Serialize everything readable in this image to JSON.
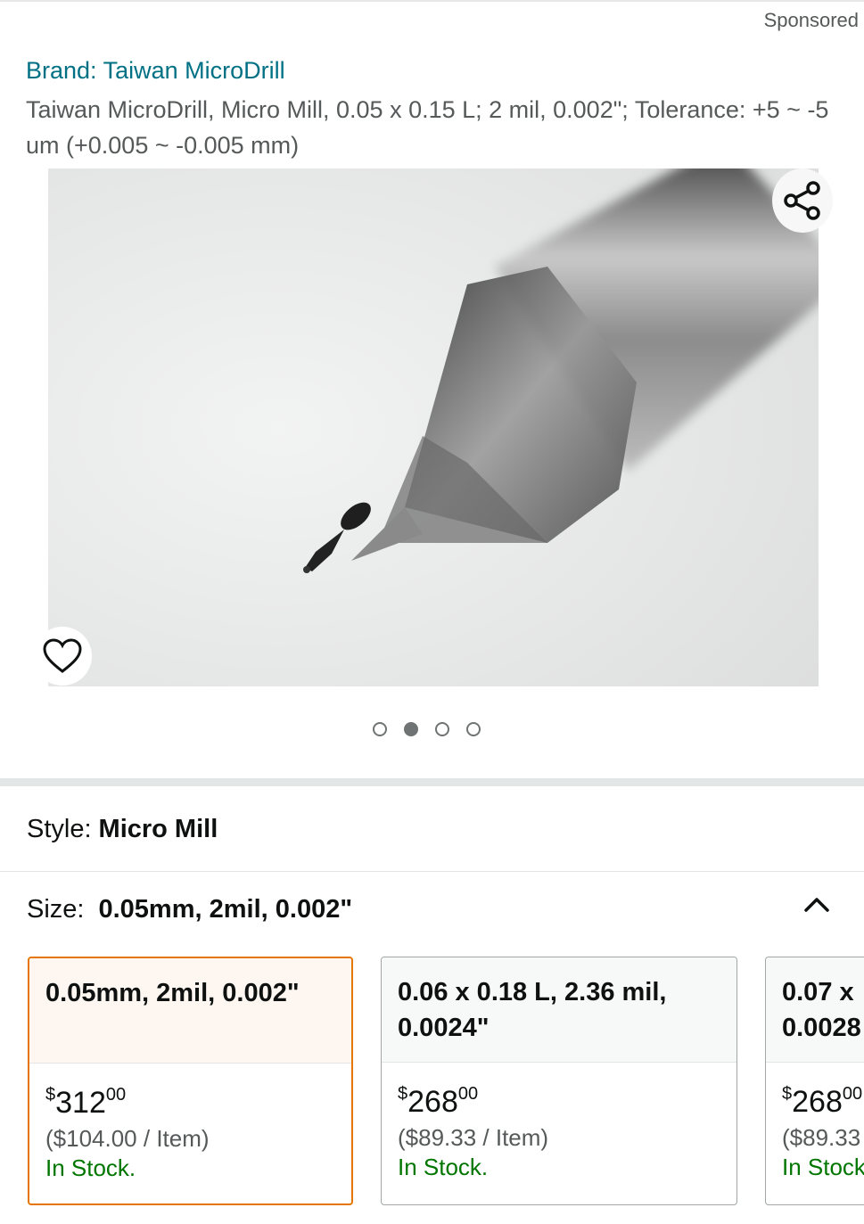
{
  "header": {
    "sponsored_label": "Sponsored"
  },
  "product": {
    "brand": "Brand: Taiwan MicroDrill",
    "title": "Taiwan MicroDrill, Micro Mill, 0.05 x 0.15 L; 2 mil, 0.002\"; Tolerance: +5 ~ -5 um (+0.005 ~ -0.005 mm)"
  },
  "gallery": {
    "image_description_icon": "micro-mill-photo",
    "share_icon": "share-icon",
    "wishlist_icon": "heart-icon",
    "dots_total": 4,
    "dots_active_index": 1
  },
  "style": {
    "label": "Style:",
    "value": "Micro Mill"
  },
  "size": {
    "label": "Size:",
    "value": "0.05mm, 2mil, 0.002\"",
    "toggle_icon": "chevron-up-icon",
    "options": [
      {
        "line1": "0.05mm, 2mil, 0.002\"",
        "line2": "",
        "price_symbol": "$",
        "price_whole": "312",
        "price_fraction": "00",
        "unit_price": "($104.00 / Item)",
        "availability": "In Stock.",
        "selected": true
      },
      {
        "line1": "0.06 x 0.18 L, 2.36 mil,",
        "line2": "0.0024\"",
        "price_symbol": "$",
        "price_whole": "268",
        "price_fraction": "00",
        "unit_price": "($89.33 / Item)",
        "availability": "In Stock.",
        "selected": false
      },
      {
        "line1": "0.07 x",
        "line2": "0.0028",
        "price_symbol": "$",
        "price_whole": "268",
        "price_fraction": "00",
        "unit_price": "($89.33",
        "availability": "In Stock",
        "selected": false
      }
    ]
  },
  "colors": {
    "link": "#007185",
    "stock": "#007600",
    "selected_border": "#e77600",
    "muted": "#565959"
  }
}
